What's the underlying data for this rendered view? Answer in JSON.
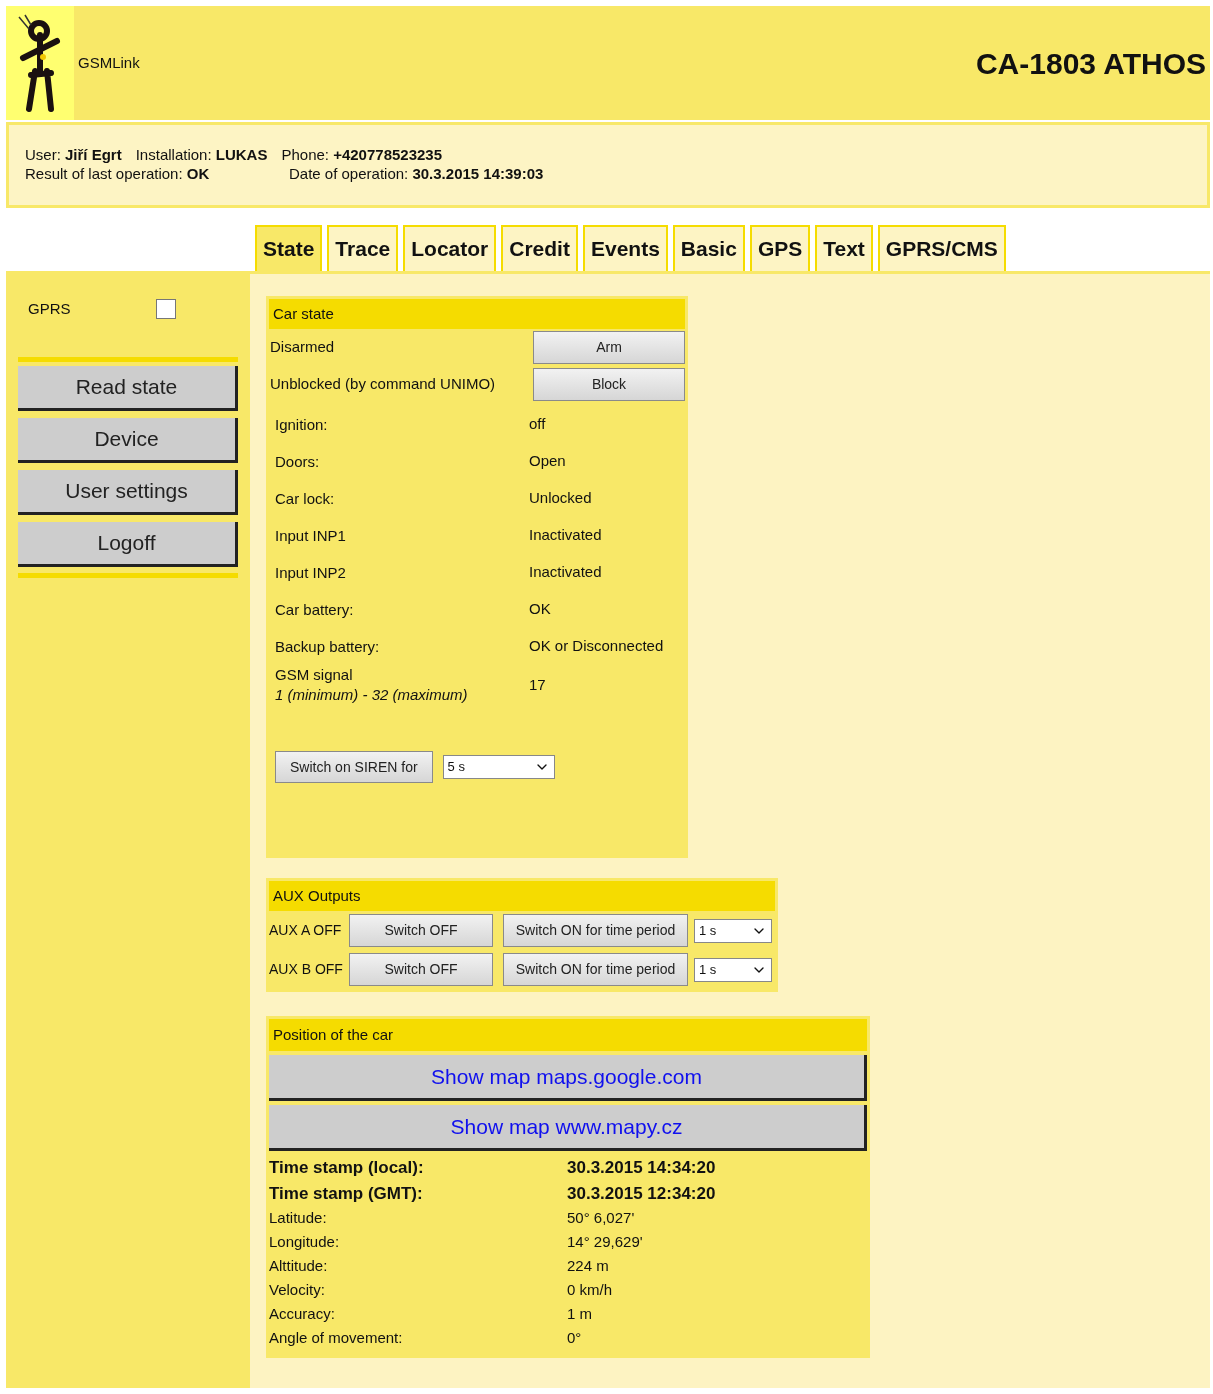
{
  "header": {
    "brand": "GSMLink",
    "device": "CA-1803 ATHOS"
  },
  "info": {
    "line_1": [
      {
        "label": "User:",
        "value": "Jiří Egrt"
      },
      {
        "label": "Installation:",
        "value": "LUKAS"
      },
      {
        "label": "Phone:",
        "value": "+420778523235"
      }
    ],
    "line_2": [
      {
        "label": "Result of last operation:",
        "value": "OK"
      },
      {
        "label": "Date of operation:",
        "value": "30.3.2015 14:39:03"
      }
    ]
  },
  "tabs": [
    {
      "label": "State",
      "selected": true
    },
    {
      "label": "Trace",
      "selected": false
    },
    {
      "label": "Locator",
      "selected": false
    },
    {
      "label": "Credit",
      "selected": false
    },
    {
      "label": "Events",
      "selected": false
    },
    {
      "label": "Basic",
      "selected": false
    },
    {
      "label": "GPS",
      "selected": false
    },
    {
      "label": "Text",
      "selected": false
    },
    {
      "label": "GPRS/CMS",
      "selected": false
    }
  ],
  "sidebar": {
    "gprs": {
      "label": "GPRS",
      "checked": false
    },
    "buttons": [
      "Read state",
      "Device",
      "User settings",
      "Logoff"
    ]
  },
  "car_state": {
    "title": "Car state",
    "commands": [
      {
        "status": "Disarmed",
        "button": "Arm"
      },
      {
        "status": "Unblocked (by command UNIMO)",
        "button": "Block"
      }
    ],
    "rows": [
      {
        "label": "Ignition:",
        "value": "off"
      },
      {
        "label": "Doors:",
        "value": "Open"
      },
      {
        "label": "Car lock:",
        "value": "Unlocked"
      },
      {
        "label": "Input INP1",
        "value": "Inactivated"
      },
      {
        "label": "Input INP2",
        "value": "Inactivated"
      },
      {
        "label": "Car battery:",
        "value": "OK"
      },
      {
        "label": "Backup battery:",
        "value": "OK or Disconnected"
      },
      {
        "label": "GSM signal",
        "note": "1 (minimum) - 32 (maximum)",
        "value": "17"
      }
    ],
    "siren": {
      "button": "Switch on SIREN for",
      "duration": "5 s"
    }
  },
  "aux": {
    "title": "AUX Outputs",
    "outputs": [
      {
        "label": "AUX A OFF",
        "off_button": "Switch OFF",
        "on_button": "Switch ON for time period",
        "period": "1 s"
      },
      {
        "label": "AUX B OFF",
        "off_button": "Switch OFF",
        "on_button": "Switch ON for time period",
        "period": "1 s"
      }
    ]
  },
  "position": {
    "title": "Position of the car",
    "links": [
      "Show map maps.google.com",
      "Show map www.mapy.cz"
    ],
    "rows": [
      {
        "label": "Time stamp (local):",
        "value": "30.3.2015 14:34:20",
        "bold": true
      },
      {
        "label": "Time stamp (GMT):",
        "value": "30.3.2015 12:34:20",
        "bold": true
      },
      {
        "label": "Latitude:",
        "value": "50° 6,027'",
        "bold": false
      },
      {
        "label": "Longitude:",
        "value": "14° 29,629'",
        "bold": false
      },
      {
        "label": "Alttitude:",
        "value": "224 m",
        "bold": false
      },
      {
        "label": "Velocity:",
        "value": "0 km/h",
        "bold": false
      },
      {
        "label": "Accuracy:",
        "value": "1 m",
        "bold": false
      },
      {
        "label": "Angle of movement:",
        "value": "0°",
        "bold": false
      }
    ]
  }
}
